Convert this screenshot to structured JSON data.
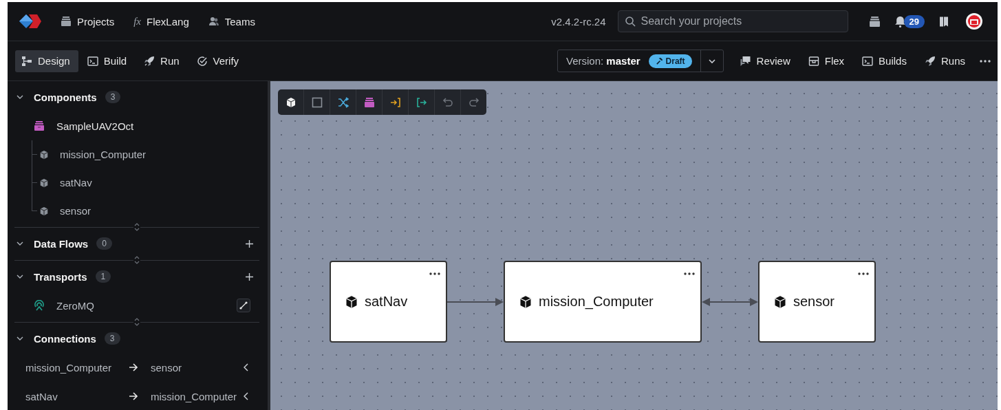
{
  "top_nav": {
    "items": [
      {
        "label": "Projects",
        "kind": "box"
      },
      {
        "label": "FlexLang",
        "kind": "formula",
        "glyph": "fx"
      },
      {
        "label": "Teams",
        "kind": "people"
      }
    ],
    "version": "v2.4.2-rc.24",
    "search": {
      "placeholder": "Search your projects"
    },
    "notifications": "29"
  },
  "mode_tabs": [
    {
      "label": "Design",
      "kind": "design",
      "selected": true
    },
    {
      "label": "Build",
      "kind": "terminal",
      "selected": false
    },
    {
      "label": "Run",
      "kind": "rocket",
      "selected": false
    },
    {
      "label": "Verify",
      "kind": "check",
      "selected": false
    }
  ],
  "version_selector": {
    "label": "Version:",
    "branch": "master",
    "status": "Draft"
  },
  "actions": [
    {
      "label": "Review",
      "kind": "chat"
    },
    {
      "label": "Flex",
      "kind": "box"
    },
    {
      "label": "Builds",
      "kind": "terminal"
    },
    {
      "label": "Runs",
      "kind": "rocket"
    }
  ],
  "sidebar": {
    "sections": [
      {
        "title": "Components",
        "count": "3",
        "expanded": true,
        "addable": false,
        "kind": "tree",
        "tree": {
          "name": "SampleUAV2Oct",
          "children": [
            {
              "name": "mission_Computer"
            },
            {
              "name": "satNav"
            },
            {
              "name": "sensor"
            }
          ]
        }
      },
      {
        "title": "Data Flows",
        "count": "0",
        "expanded": true,
        "addable": true,
        "kind": "empty"
      },
      {
        "title": "Transports",
        "count": "1",
        "expanded": true,
        "addable": true,
        "kind": "transports",
        "items": [
          {
            "name": "ZeroMQ"
          }
        ]
      },
      {
        "title": "Connections",
        "count": "3",
        "expanded": true,
        "addable": false,
        "kind": "connections",
        "items": [
          {
            "from": "mission_Computer",
            "to": "sensor"
          },
          {
            "from": "satNav",
            "to": "mission_Computer"
          }
        ]
      }
    ]
  },
  "canvas": {
    "nodes": [
      {
        "name": "satNav"
      },
      {
        "name": "mission_Computer"
      },
      {
        "name": "sensor"
      }
    ],
    "edges": [
      {
        "kind": "forward"
      },
      {
        "kind": "both"
      }
    ]
  }
}
